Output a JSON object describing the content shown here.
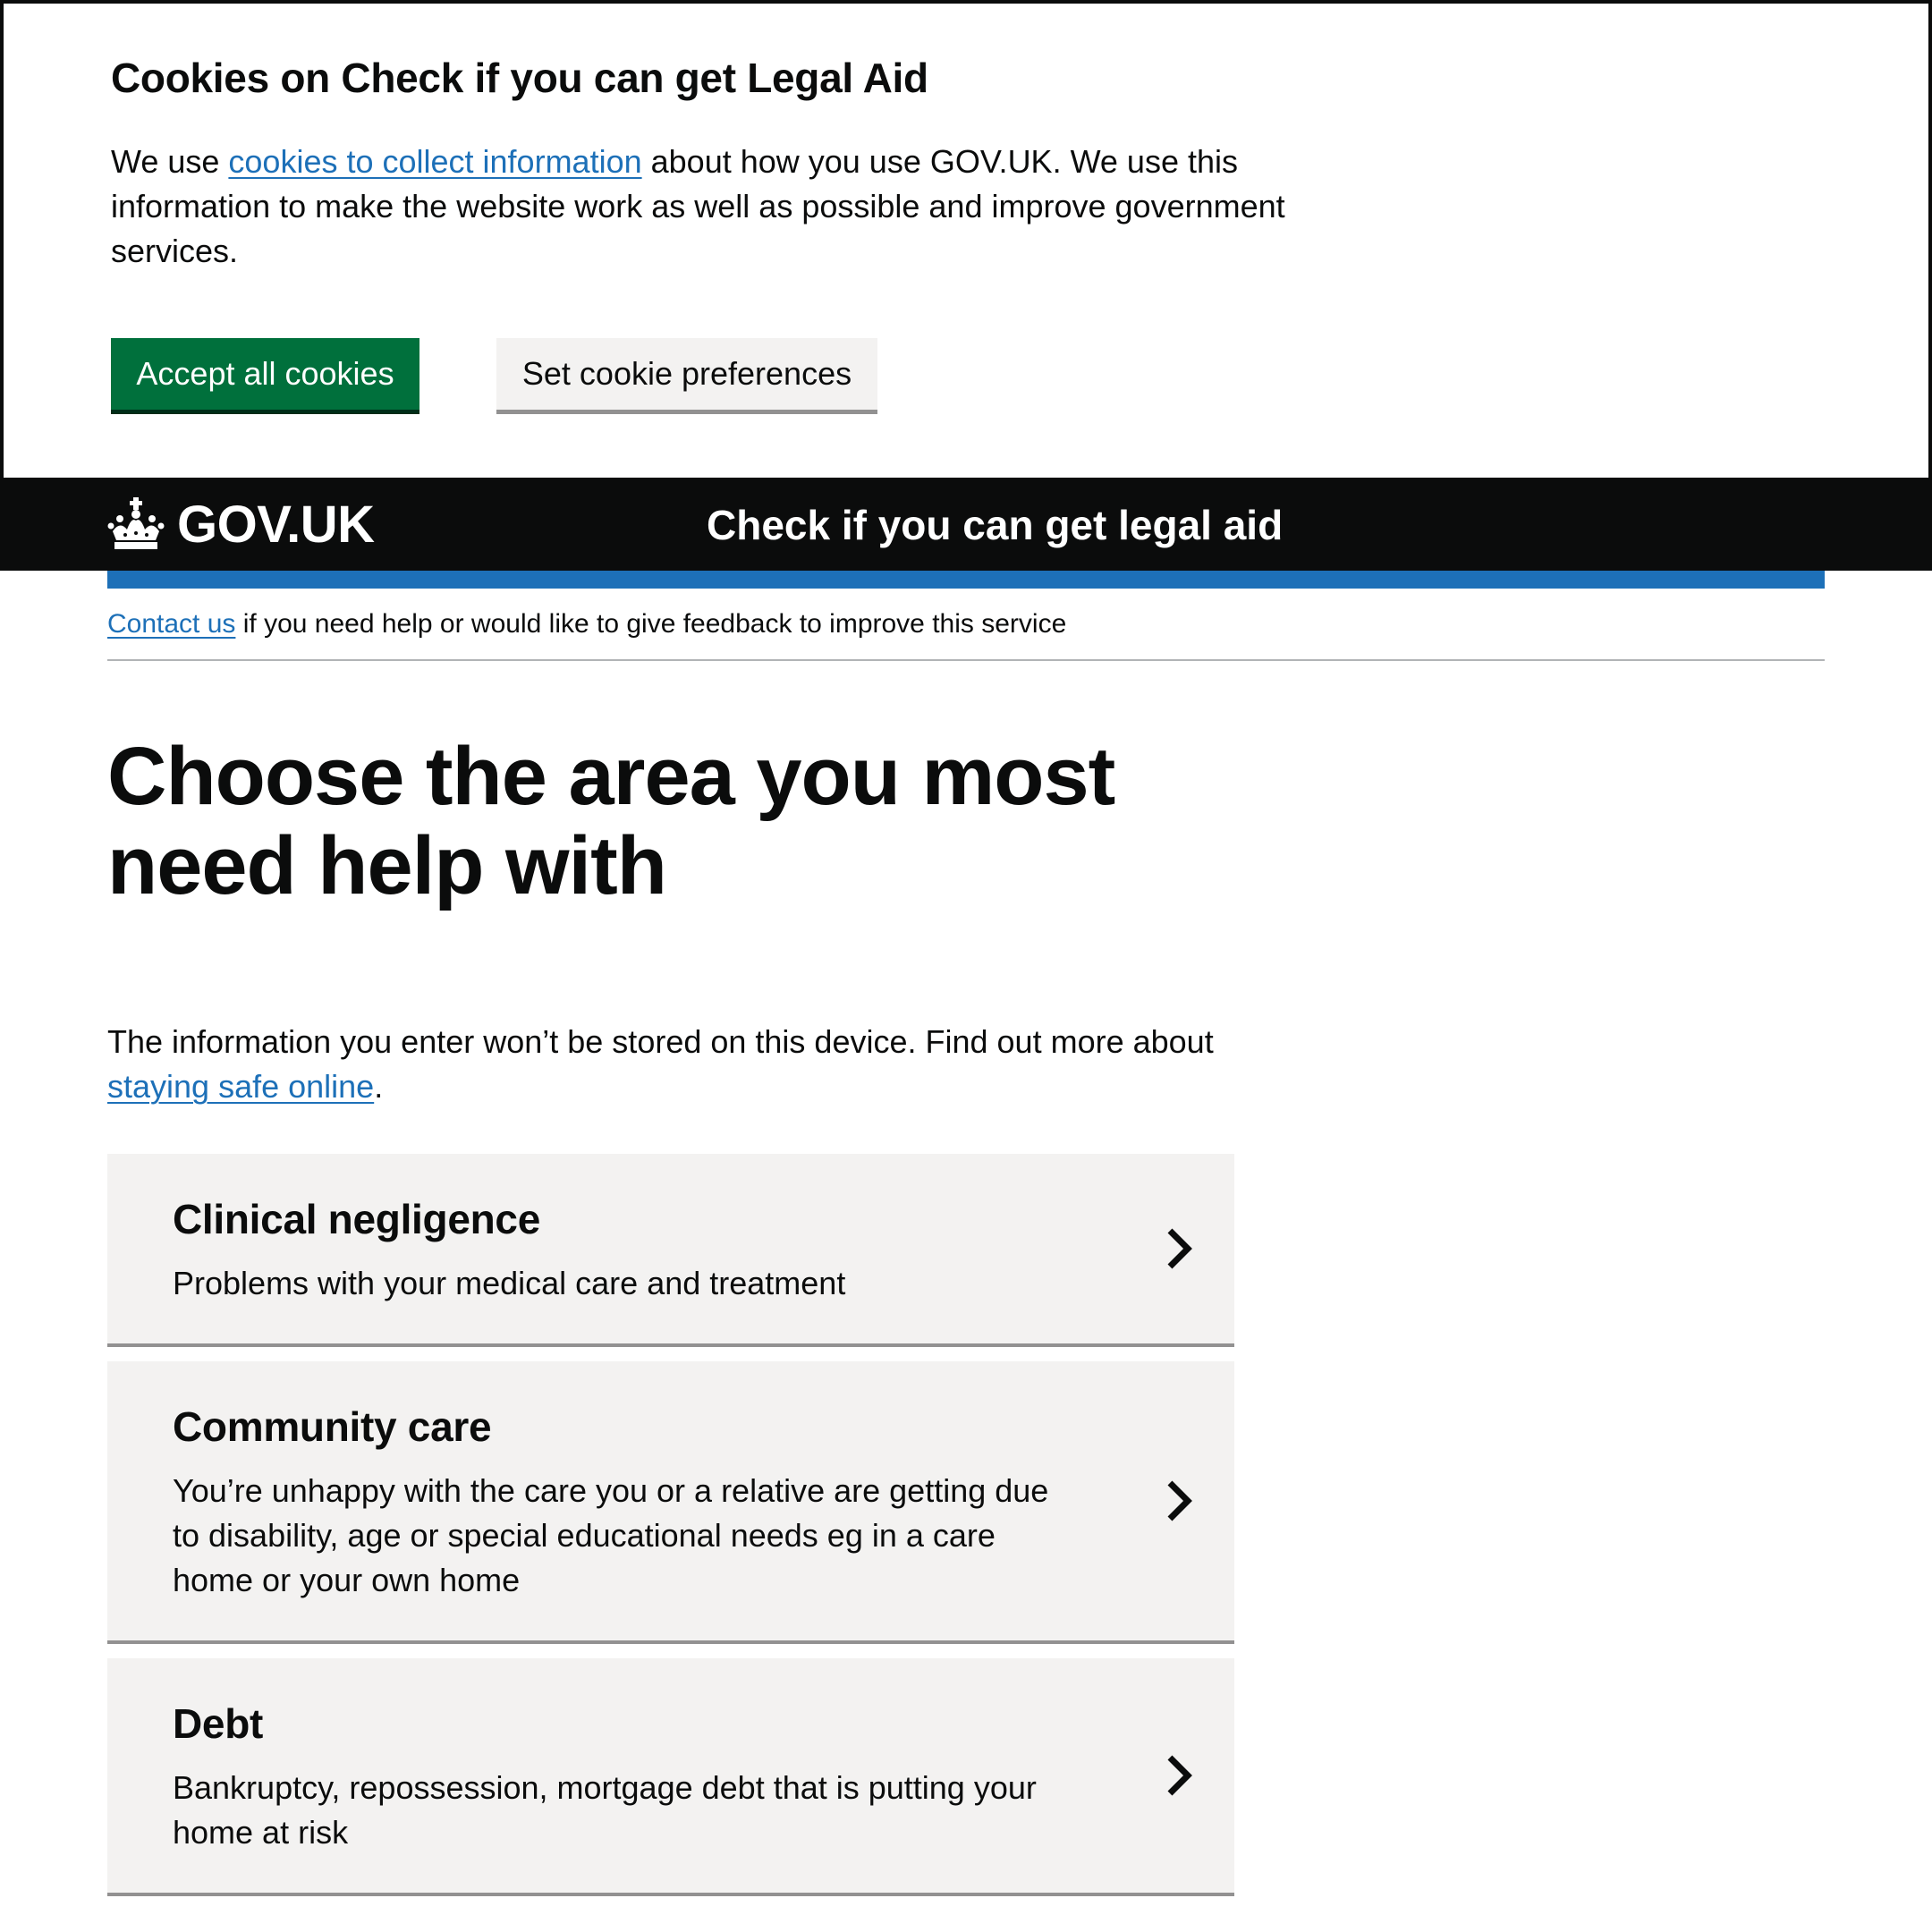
{
  "cookie_banner": {
    "title": "Cookies on Check if you can get Legal Aid",
    "text_before_link": "We use ",
    "link_text": "cookies to collect information",
    "text_after_link": " about how you use GOV.UK. We use this information to make the website work as well as possible and improve government services.",
    "accept_label": "Accept all cookies",
    "preferences_label": "Set cookie preferences",
    "accept_color": "#00703c"
  },
  "header": {
    "logo_text": "GOV.UK",
    "logo_icon": "crown-icon",
    "service_name": "Check if you can get legal aid",
    "stripe_color": "#1d70b8"
  },
  "contact_banner": {
    "link_text": "Contact us",
    "text": " if you need help or would like to give feedback to improve this service"
  },
  "main": {
    "title": "Choose the area you most need help with",
    "intro_text": "The information you enter won’t be stored on this device. Find out more about ",
    "intro_link": "staying safe online",
    "intro_end": ".",
    "categories": [
      {
        "title": "Clinical negligence",
        "description": "Problems with your medical care and treatment",
        "icon": "chevron-right-icon"
      },
      {
        "title": "Community care",
        "description": "You’re unhappy with the care you or a relative are getting due to disability, age or special educational needs eg in a care home or your own home",
        "icon": "chevron-right-icon"
      },
      {
        "title": "Debt",
        "description": "Bankruptcy, repossession, mortgage debt that is putting your home at risk",
        "icon": "chevron-right-icon"
      }
    ]
  }
}
